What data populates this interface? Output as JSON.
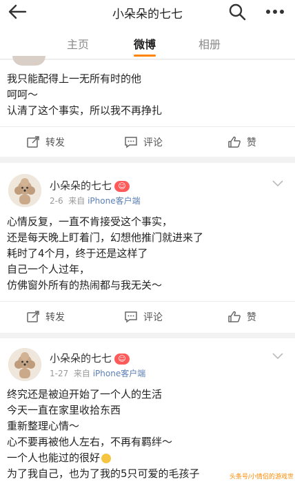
{
  "header": {
    "title": "小朵朵的七七"
  },
  "tabs": [
    {
      "label": "主页"
    },
    {
      "label": "微博"
    },
    {
      "label": "相册"
    }
  ],
  "posts": [
    {
      "lines": [
        "我只能配得上一无所有时的他",
        "呵呵～",
        "认清了这个事实，所以我不再挣扎"
      ],
      "actions": {
        "repost": "转发",
        "comment": "评论",
        "like": "赞"
      }
    },
    {
      "username": "小朵朵的七七",
      "date": "2-6",
      "from_prefix": "来自",
      "source": "iPhone客户端",
      "lines": [
        "心情反复，一直不肯接受这个事实，",
        "还是每天晚上盯着门，幻想他推门就进来了",
        "耗时了4个月，终于还是这样了",
        "自己一个人过年，",
        "仿佛窗外所有的热闹都与我无关～"
      ],
      "actions": {
        "repost": "转发",
        "comment": "评论",
        "like": "赞"
      }
    },
    {
      "username": "小朵朵的七七",
      "date": "1-27",
      "from_prefix": "来自",
      "source": "iPhone客户端",
      "lines": [
        "终究还是被迫开始了一个人的生活",
        "今天一直在家里收拾东西",
        "重新整理心情～",
        "心不要再被他人左右，不再有羁绊～",
        "一个人也能过的很好",
        "为了我自己，也为了我的5只可爱的毛孩子"
      ]
    }
  ],
  "watermark": "头条号/小情侣的游戏世界",
  "colors": {
    "accent": "#ff8200",
    "source_link": "#5b7fb5"
  }
}
